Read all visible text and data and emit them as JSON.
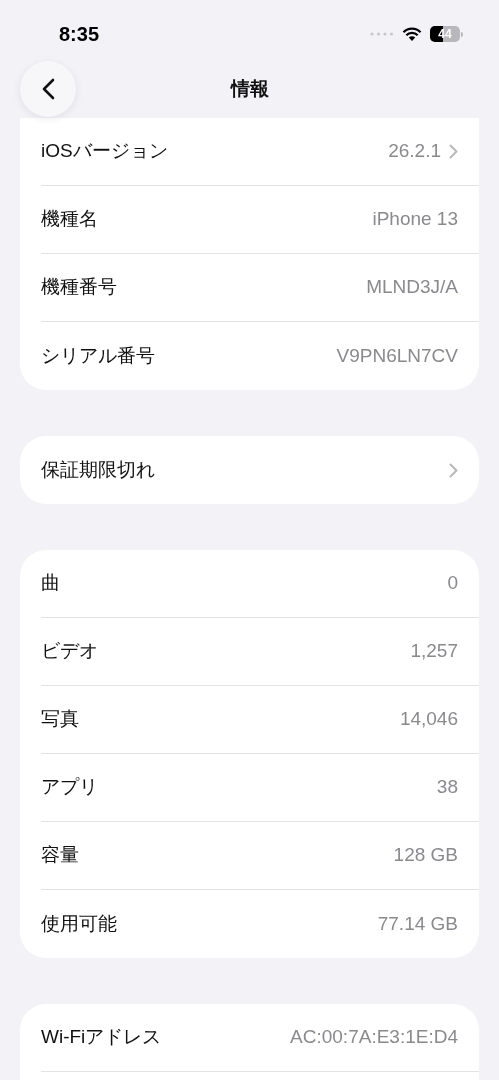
{
  "status_bar": {
    "time": "8:35",
    "battery": "44"
  },
  "nav": {
    "title": "情報"
  },
  "sections": [
    {
      "rows": [
        {
          "label": "iOSバージョン",
          "value": "26.2.1",
          "disclosure": true
        },
        {
          "label": "機種名",
          "value": "iPhone 13",
          "disclosure": false
        },
        {
          "label": "機種番号",
          "value": "MLND3J/A",
          "disclosure": false
        },
        {
          "label": "シリアル番号",
          "value": "V9PN6LN7CV",
          "disclosure": false
        }
      ]
    },
    {
      "rows": [
        {
          "label": "保証期限切れ",
          "disclosure": true
        }
      ]
    },
    {
      "rows": [
        {
          "label": "曲",
          "value": "0",
          "disclosure": false
        },
        {
          "label": "ビデオ",
          "value": "1,257",
          "disclosure": false
        },
        {
          "label": "写真",
          "value": "14,046",
          "disclosure": false
        },
        {
          "label": "アプリ",
          "value": "38",
          "disclosure": false
        },
        {
          "label": "容量",
          "value": "128 GB",
          "disclosure": false
        },
        {
          "label": "使用可能",
          "value": "77.14 GB",
          "disclosure": false
        }
      ]
    },
    {
      "rows": [
        {
          "label": "Wi-Fiアドレス",
          "value": "AC:00:7A:E3:1E:D4",
          "disclosure": false
        }
      ]
    }
  ]
}
